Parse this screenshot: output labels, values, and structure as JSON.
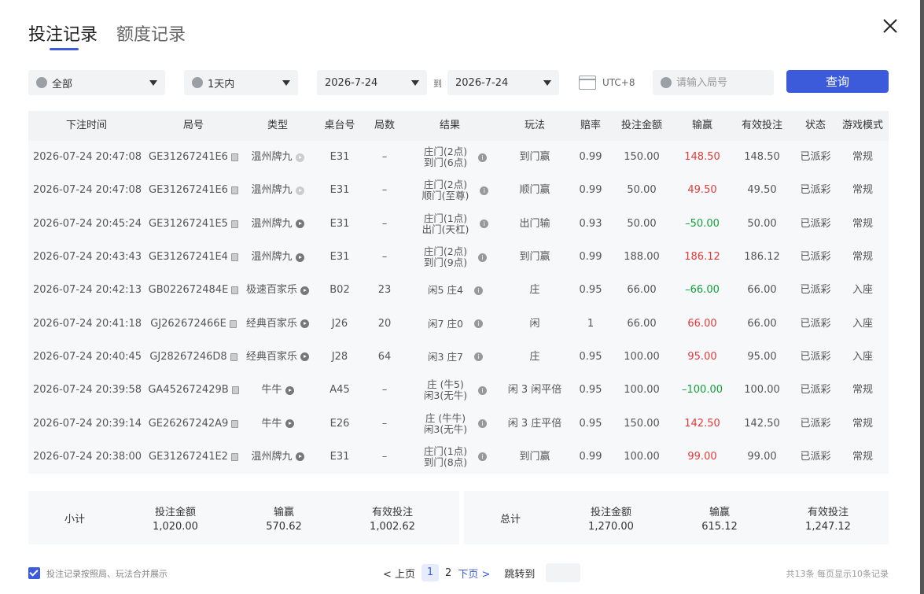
{
  "tabs": [
    "投注记录",
    "额度记录"
  ],
  "filters": {
    "game": "全部",
    "period": "1天内",
    "date_from": "2026-7-24",
    "to_label": "到",
    "date_to": "2026-7-24",
    "timezone": "UTC+8",
    "search_placeholder": "请输入局号",
    "query_label": "查询"
  },
  "table": {
    "headers": [
      "下注时间",
      "局号",
      "类型",
      "桌台号",
      "局数",
      "结果",
      "玩法",
      "赔率",
      "投注金额",
      "输赢",
      "有效投注",
      "状态",
      "游戏模式"
    ],
    "rows": [
      {
        "time": "2026-07-24 20:47:08",
        "id": "GE31267241E6",
        "type": "温州牌九",
        "table": "E31",
        "round": "–",
        "r1": "庄门(2点)",
        "r2": "到门(6点)",
        "play": "到门赢",
        "odds": "0.99",
        "bet": "150.00",
        "win": "148.50",
        "win_sign": "pos",
        "valid": "148.50",
        "status": "已派彩",
        "mode": "常规",
        "icon_light": true
      },
      {
        "time": "2026-07-24 20:47:08",
        "id": "GE31267241E6",
        "type": "温州牌九",
        "table": "E31",
        "round": "–",
        "r1": "庄门(2点)",
        "r2": "顺门(至尊)",
        "play": "顺门赢",
        "odds": "0.99",
        "bet": "50.00",
        "win": "49.50",
        "win_sign": "pos",
        "valid": "49.50",
        "status": "已派彩",
        "mode": "常规",
        "icon_light": true
      },
      {
        "time": "2026-07-24 20:45:24",
        "id": "GE31267241E5",
        "type": "温州牌九",
        "table": "E31",
        "round": "–",
        "r1": "庄门(1点)",
        "r2": "出门(天杠)",
        "play": "出门输",
        "odds": "0.93",
        "bet": "50.00",
        "win": "–50.00",
        "win_sign": "neg",
        "valid": "50.00",
        "status": "已派彩",
        "mode": "常规",
        "icon_light": false
      },
      {
        "time": "2026-07-24 20:43:43",
        "id": "GE31267241E4",
        "type": "温州牌九",
        "table": "E31",
        "round": "–",
        "r1": "庄门(2点)",
        "r2": "到门(9点)",
        "play": "到门赢",
        "odds": "0.99",
        "bet": "188.00",
        "win": "186.12",
        "win_sign": "pos",
        "valid": "186.12",
        "status": "已派彩",
        "mode": "常规",
        "icon_light": false
      },
      {
        "time": "2026-07-24 20:42:13",
        "id": "GB022672484E",
        "type": "极速百家乐",
        "table": "B02",
        "round": "23",
        "r1": "闲5 庄4",
        "r2": "",
        "play": "庄",
        "odds": "0.95",
        "bet": "66.00",
        "win": "–66.00",
        "win_sign": "neg",
        "valid": "66.00",
        "status": "已派彩",
        "mode": "入座",
        "icon_light": false
      },
      {
        "time": "2026-07-24 20:41:18",
        "id": "GJ262672466E",
        "type": "经典百家乐",
        "table": "J26",
        "round": "20",
        "r1": "闲7 庄0",
        "r2": "",
        "play": "闲",
        "odds": "1",
        "bet": "66.00",
        "win": "66.00",
        "win_sign": "pos",
        "valid": "66.00",
        "status": "已派彩",
        "mode": "入座",
        "icon_light": false
      },
      {
        "time": "2026-07-24 20:40:45",
        "id": "GJ28267246D8",
        "type": "经典百家乐",
        "table": "J28",
        "round": "64",
        "r1": "闲3 庄7",
        "r2": "",
        "play": "庄",
        "odds": "0.95",
        "bet": "100.00",
        "win": "95.00",
        "win_sign": "pos",
        "valid": "95.00",
        "status": "已派彩",
        "mode": "入座",
        "icon_light": false
      },
      {
        "time": "2026-07-24 20:39:58",
        "id": "GA452672429B",
        "type": "牛牛",
        "table": "A45",
        "round": "–",
        "r1": "庄 (牛5)",
        "r2": "闲3(无牛)",
        "play": "闲 3 闲平倍",
        "odds": "0.95",
        "bet": "100.00",
        "win": "–100.00",
        "win_sign": "neg",
        "valid": "100.00",
        "status": "已派彩",
        "mode": "常规",
        "icon_light": false
      },
      {
        "time": "2026-07-24 20:39:14",
        "id": "GE26267242A9",
        "type": "牛牛",
        "table": "E26",
        "round": "–",
        "r1": "庄 (牛牛)",
        "r2": "闲3(无牛)",
        "play": "闲 3 庄平倍",
        "odds": "0.95",
        "bet": "150.00",
        "win": "142.50",
        "win_sign": "pos",
        "valid": "142.50",
        "status": "已派彩",
        "mode": "常规",
        "icon_light": false
      },
      {
        "time": "2026-07-24 20:38:00",
        "id": "GE31267241E2",
        "type": "温州牌九",
        "table": "E31",
        "round": "–",
        "r1": "庄门(1点)",
        "r2": "到门(8点)",
        "play": "到门赢",
        "odds": "0.99",
        "bet": "100.00",
        "win": "99.00",
        "win_sign": "pos",
        "valid": "99.00",
        "status": "已派彩",
        "mode": "常规",
        "icon_light": false
      }
    ]
  },
  "subtotal": {
    "label": "小计",
    "bet_label": "投注金额",
    "bet": "1,020.00",
    "win_label": "输赢",
    "win": "570.62",
    "valid_label": "有效投注",
    "valid": "1,002.62"
  },
  "total": {
    "label": "总计",
    "bet_label": "投注金额",
    "bet": "1,270.00",
    "win_label": "输赢",
    "win": "615.12",
    "valid_label": "有效投注",
    "valid": "1,247.12"
  },
  "footer": {
    "merge_label": "投注记录按照局、玩法合并展示",
    "prev": "< 上页",
    "pages": [
      "1",
      "2"
    ],
    "next": "下页 >",
    "jump": "跳转到",
    "count": "共13条   每页显示10条记录"
  },
  "colors": {
    "accent": "#3b5bdb",
    "win": "#e03a3a",
    "loss": "#12a03a"
  }
}
